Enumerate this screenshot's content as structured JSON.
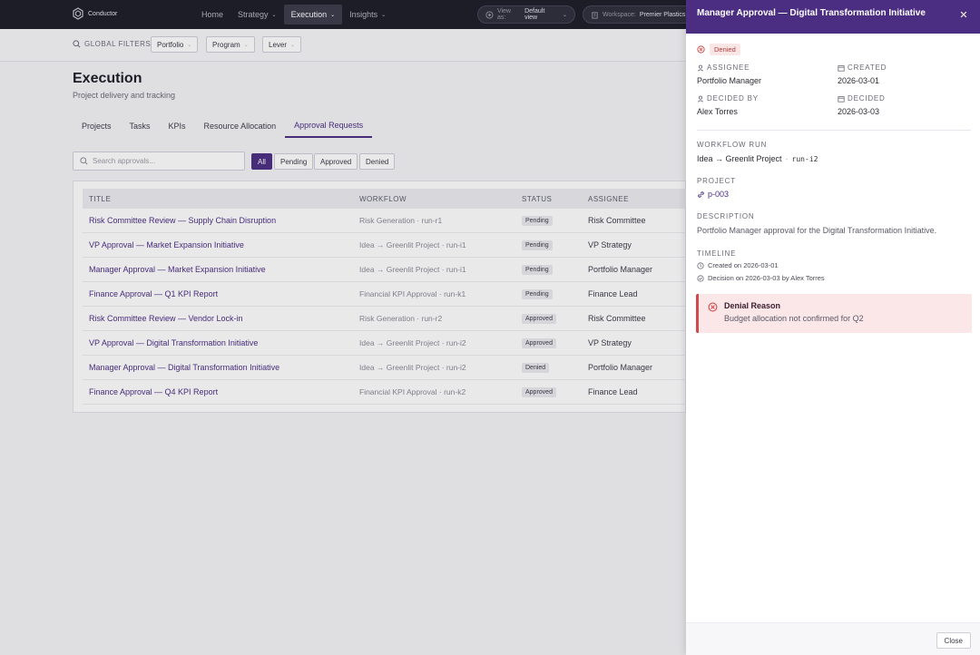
{
  "app": {
    "name": "Conductor"
  },
  "nav": {
    "items": [
      {
        "label": "Home",
        "caret": false
      },
      {
        "label": "Strategy",
        "caret": true
      },
      {
        "label": "Execution",
        "caret": true,
        "active": true
      },
      {
        "label": "Insights",
        "caret": true
      }
    ]
  },
  "view_as": {
    "label": "View as:",
    "value": "Default view"
  },
  "workspace": {
    "label": "Workspace:",
    "value": "Premier Plastics"
  },
  "filters": {
    "label": "GLOBAL FILTERS",
    "buttons": [
      "Portfolio",
      "Program",
      "Lever"
    ]
  },
  "page": {
    "title": "Execution",
    "subtitle": "Project delivery and tracking"
  },
  "tabs": [
    "Projects",
    "Tasks",
    "KPIs",
    "Resource Allocation",
    "Approval Requests"
  ],
  "search": {
    "placeholder": "Search approvals..."
  },
  "status_filters": [
    "All",
    "Pending",
    "Approved",
    "Denied"
  ],
  "table": {
    "headers": {
      "title": "TITLE",
      "workflow": "WORKFLOW",
      "status": "STATUS",
      "assignee": "ASSIGNEE"
    },
    "rows": [
      {
        "title": "Risk Committee Review — Supply Chain Disruption",
        "workflow": "Risk Generation · run-r1",
        "status": "Pending",
        "assignee": "Risk Committee"
      },
      {
        "title": "VP Approval — Market Expansion Initiative",
        "workflow": "Idea → Greenlit Project · run-i1",
        "status": "Pending",
        "assignee": "VP Strategy"
      },
      {
        "title": "Manager Approval — Market Expansion Initiative",
        "workflow": "Idea → Greenlit Project · run-i1",
        "status": "Pending",
        "assignee": "Portfolio Manager"
      },
      {
        "title": "Finance Approval — Q1 KPI Report",
        "workflow": "Financial KPI Approval · run-k1",
        "status": "Pending",
        "assignee": "Finance Lead"
      },
      {
        "title": "Risk Committee Review — Vendor Lock-in",
        "workflow": "Risk Generation · run-r2",
        "status": "Approved",
        "assignee": "Risk Committee"
      },
      {
        "title": "VP Approval — Digital Transformation Initiative",
        "workflow": "Idea → Greenlit Project · run-i2",
        "status": "Approved",
        "assignee": "VP Strategy"
      },
      {
        "title": "Manager Approval — Digital Transformation Initiative",
        "workflow": "Idea → Greenlit Project · run-i2",
        "status": "Denied",
        "assignee": "Portfolio Manager"
      },
      {
        "title": "Finance Approval — Q4 KPI Report",
        "workflow": "Financial KPI Approval · run-k2",
        "status": "Approved",
        "assignee": "Finance Lead"
      }
    ]
  },
  "drawer": {
    "title": "Manager Approval — Digital Transformation Initiative",
    "status": "Denied",
    "assignee_label": "ASSIGNEE",
    "assignee": "Portfolio Manager",
    "created_label": "CREATED",
    "created": "2026-03-01",
    "decided_by_label": "DECIDED BY",
    "decided_by": "Alex Torres",
    "decided_label": "DECIDED",
    "decided": "2026-03-03",
    "workflow_run_label": "WORKFLOW RUN",
    "workflow_name": "Idea → Greenlit Project",
    "workflow_sep": "·",
    "workflow_run_id": "run-i2",
    "project_label": "PROJECT",
    "project": "p-003",
    "description_label": "DESCRIPTION",
    "description": "Portfolio Manager approval for the Digital Transformation Initiative.",
    "timeline_label": "TIMELINE",
    "timeline": [
      "Created on 2026-03-01",
      "Decision on 2026-03-03 by Alex Torres"
    ],
    "denial_title": "Denial Reason",
    "denial_text": "Budget allocation not confirmed for Q2",
    "close_label": "Close"
  },
  "colors": {
    "accent": "#4b2d82",
    "topbar": "#1c1c28",
    "denied": "#d14a4a"
  }
}
